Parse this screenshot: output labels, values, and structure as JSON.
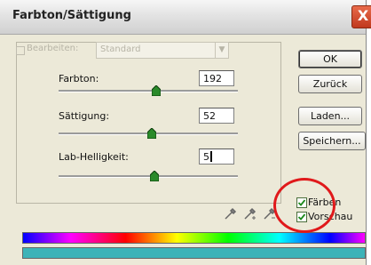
{
  "window": {
    "title": "Farbton/Sättigung",
    "close_glyph": "X"
  },
  "edit": {
    "label": "Bearbeiten:",
    "selected": "Standard"
  },
  "controls": [
    {
      "label": "Farbton:",
      "value": "192"
    },
    {
      "label": "Sättigung:",
      "value": "52"
    },
    {
      "label": "Lab-Helligkeit:",
      "value": "5"
    }
  ],
  "buttons": {
    "ok": "OK",
    "reset": "Zurück",
    "load": "Laden...",
    "save": "Speichern..."
  },
  "options": {
    "colorize_label": "Färben",
    "preview_label": "Vorschau",
    "colorize_checked": true,
    "preview_checked": true
  },
  "icons": [
    "eyedropper-icon",
    "eyedropper-plus-icon",
    "eyedropper-minus-icon"
  ],
  "colors": {
    "result_bar": "#3cb3b8",
    "annotation": "#e0191b"
  }
}
